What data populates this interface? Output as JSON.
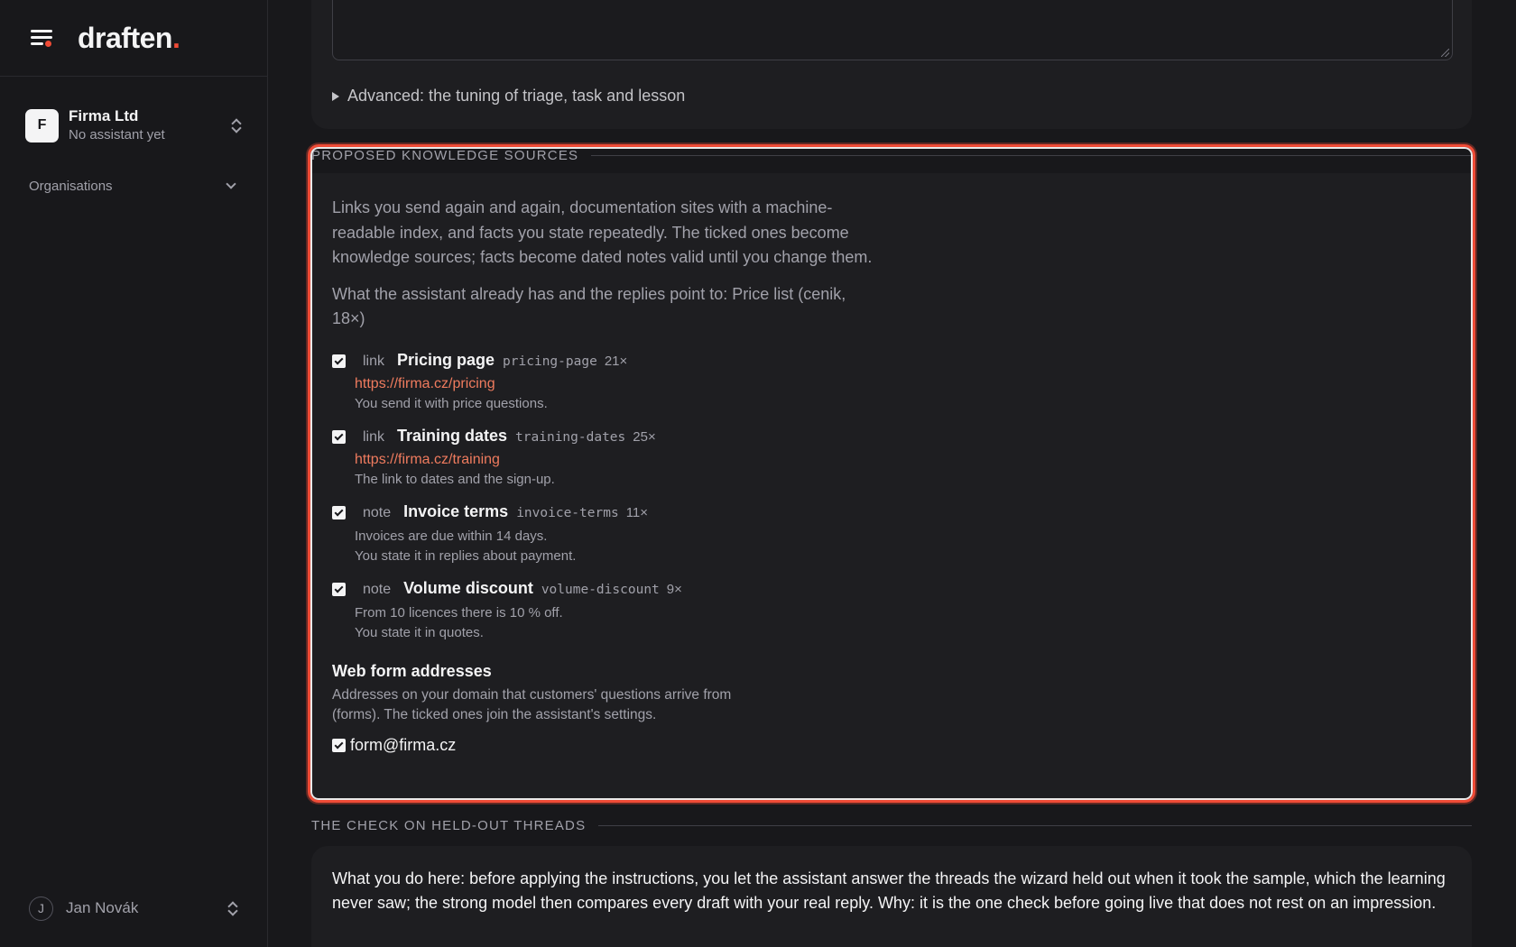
{
  "brand": {
    "name": "draften",
    "dot": "."
  },
  "sidebar": {
    "org_initial": "F",
    "org_name": "Firma Ltd",
    "org_subtitle": "No assistant yet",
    "organisations_label": "Organisations",
    "user_initial": "J",
    "user_name": "Jan Novák"
  },
  "top_card": {
    "advanced_label": "Advanced: the tuning of triage, task and lesson"
  },
  "knowledge_sources": {
    "heading": "PROPOSED KNOWLEDGE SOURCES",
    "intro": "Links you send again and again, documentation sites with a machine-readable index, and facts you state repeatedly. The ticked ones become knowledge sources; facts become dated notes valid until you change them.",
    "already_has": "What the assistant already has and the replies point to: Price list (cenik, 18×)",
    "items": [
      {
        "checked": true,
        "kind": "link",
        "title": "Pricing page",
        "slug": "pricing-page",
        "count": "21×",
        "url": "https://firma.cz/pricing",
        "desc": "You send it with price questions."
      },
      {
        "checked": true,
        "kind": "link",
        "title": "Training dates",
        "slug": "training-dates",
        "count": "25×",
        "url": "https://firma.cz/training",
        "desc": "The link to dates and the sign-up."
      },
      {
        "checked": true,
        "kind": "note",
        "title": "Invoice terms",
        "slug": "invoice-terms",
        "count": "11×",
        "fact": "Invoices are due within 14 days.",
        "desc": "You state it in replies about payment."
      },
      {
        "checked": true,
        "kind": "note",
        "title": "Volume discount",
        "slug": "volume-discount",
        "count": "9×",
        "fact": "From 10 licences there is 10 % off.",
        "desc": "You state it in quotes."
      }
    ],
    "web_forms": {
      "title": "Web form addresses",
      "desc": "Addresses on your domain that customers' questions arrive from (forms). The ticked ones join the assistant's settings.",
      "addresses": [
        {
          "checked": true,
          "address": "form@firma.cz"
        }
      ]
    }
  },
  "held_out": {
    "heading": "THE CHECK ON HELD-OUT THREADS",
    "text": "What you do here: before applying the instructions, you let the assistant answer the threads the wizard held out when it took the sample, which the learning never saw; the strong model then compares every draft with your real reply. Why: it is the one check before going live that does not rest on an impression."
  },
  "colors": {
    "accent": "#ef4b36",
    "background": "#18181b",
    "card": "#1e1e21",
    "link": "#ef7b5e"
  },
  "icons": [
    "menu-icon",
    "updown-icon",
    "chevron-down-icon",
    "disclosure-triangle-icon",
    "checkbox-checked-icon",
    "resize-handle-icon"
  ]
}
